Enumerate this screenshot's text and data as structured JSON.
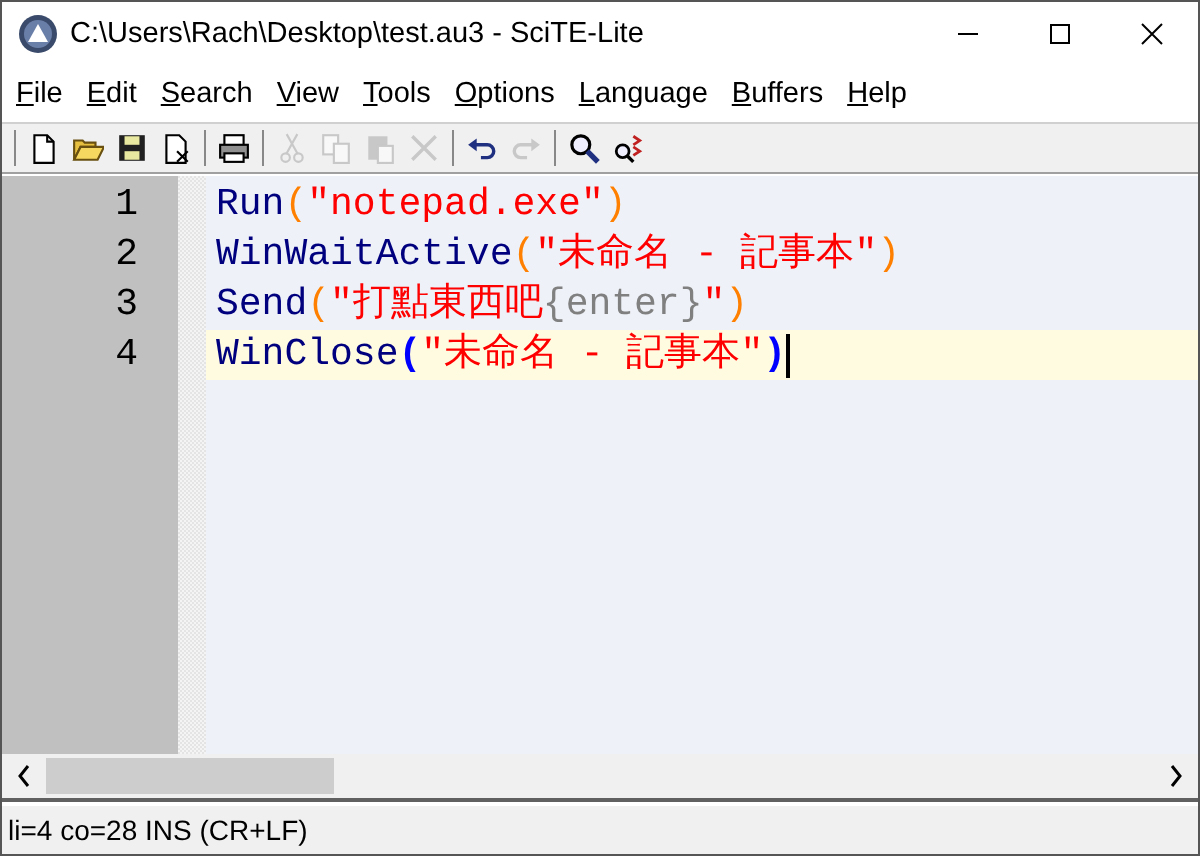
{
  "window": {
    "title": "C:\\Users\\Rach\\Desktop\\test.au3 - SciTE-Lite"
  },
  "menu": [
    "File",
    "Edit",
    "Search",
    "View",
    "Tools",
    "Options",
    "Language",
    "Buffers",
    "Help"
  ],
  "toolbar": [
    {
      "kind": "new",
      "disabled": false
    },
    {
      "kind": "open",
      "disabled": false
    },
    {
      "kind": "save",
      "disabled": false
    },
    {
      "kind": "close",
      "disabled": false
    },
    {
      "kind": "sep"
    },
    {
      "kind": "print",
      "disabled": false
    },
    {
      "kind": "sep"
    },
    {
      "kind": "cut",
      "disabled": true
    },
    {
      "kind": "copy",
      "disabled": true
    },
    {
      "kind": "paste",
      "disabled": true
    },
    {
      "kind": "delete",
      "disabled": true
    },
    {
      "kind": "sep"
    },
    {
      "kind": "undo",
      "disabled": false
    },
    {
      "kind": "redo",
      "disabled": true
    },
    {
      "kind": "sep"
    },
    {
      "kind": "find",
      "disabled": false
    },
    {
      "kind": "replace",
      "disabled": false
    }
  ],
  "editor": {
    "lines": [
      {
        "number": "1",
        "current": false,
        "tokens": [
          {
            "kind": "function",
            "text": "Run"
          },
          {
            "kind": "paren",
            "text": "("
          },
          {
            "kind": "string",
            "text": "\"notepad.exe\""
          },
          {
            "kind": "paren",
            "text": ")"
          }
        ]
      },
      {
        "number": "2",
        "current": false,
        "tokens": [
          {
            "kind": "function",
            "text": "WinWaitActive"
          },
          {
            "kind": "paren",
            "text": "("
          },
          {
            "kind": "string",
            "text": "\"未命名 - 記事本\""
          },
          {
            "kind": "paren",
            "text": ")"
          }
        ]
      },
      {
        "number": "3",
        "current": false,
        "tokens": [
          {
            "kind": "function",
            "text": "Send"
          },
          {
            "kind": "paren",
            "text": "("
          },
          {
            "kind": "string",
            "text": "\"打點東西吧"
          },
          {
            "kind": "sendkey",
            "text": "{enter}"
          },
          {
            "kind": "string",
            "text": "\""
          },
          {
            "kind": "paren",
            "text": ")"
          }
        ]
      },
      {
        "number": "4",
        "current": true,
        "tokens": [
          {
            "kind": "function",
            "text": "WinClose"
          },
          {
            "kind": "brace-match",
            "text": "("
          },
          {
            "kind": "string",
            "text": "\"未命名 - 記事本\""
          },
          {
            "kind": "brace-match",
            "text": ")"
          }
        ]
      }
    ]
  },
  "status_bar": "li=4 co=28 INS (CR+LF)"
}
